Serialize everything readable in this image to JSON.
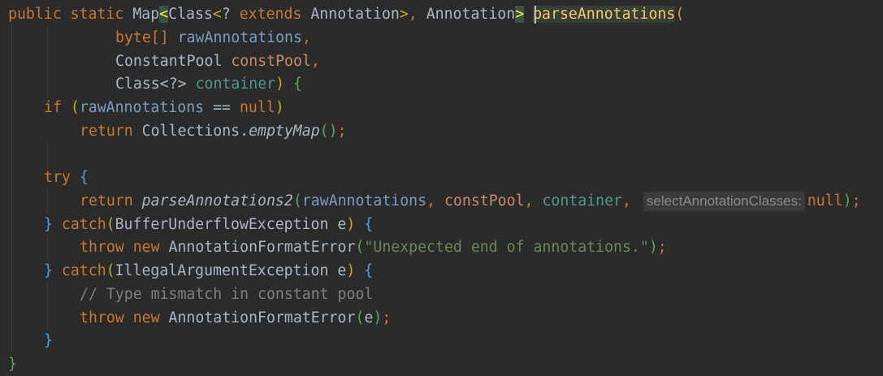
{
  "code": {
    "l1": {
      "public": "public",
      "static": "static",
      "map": "Map",
      "lt": "<",
      "class": "Class",
      "lt2": "<",
      "q": "?",
      "extends": "extends",
      "annotation": "Annotation",
      "gt2": ">",
      "comma": ",",
      "annotation2": "Annotation",
      "gt": ">",
      "method": "parseAnnotations",
      "open": "("
    },
    "l2": {
      "type": "byte[]",
      "name": "rawAnnotations",
      "comma": ","
    },
    "l3": {
      "type": "ConstantPool",
      "name": "constPool",
      "comma": ","
    },
    "l4": {
      "type": "Class",
      "gen": "<?>",
      "name": "container",
      "close": ")",
      "brace": "{"
    },
    "l5": {
      "if": "if",
      "open": "(",
      "name": "rawAnnotations",
      "op": " == ",
      "null": "null",
      "close": ")"
    },
    "l6": {
      "return": "return",
      "cls": "Collections.",
      "call": "emptyMap",
      "parens": "()",
      "semi": ";"
    },
    "l8": {
      "try": "try",
      "brace": "{"
    },
    "l9": {
      "return": "return",
      "call": "parseAnnotations2",
      "open": "(",
      "a1": "rawAnnotations",
      "sep1": ", ",
      "a2": "constPool",
      "sep2": ", ",
      "a3": "container",
      "sep3": ",",
      "hint": "selectAnnotationClasses:",
      "null": "null",
      "close": ")",
      "semi": ";"
    },
    "l10": {
      "close": "}",
      "catch": "catch",
      "open": "(",
      "exc": "BufferUnderflowException",
      "var": "e",
      "cparen": ")",
      "brace": "{"
    },
    "l11": {
      "throw": "throw",
      "new": "new",
      "cls": "AnnotationFormatError",
      "open": "(",
      "str": "\"Unexpected end of annotations.\"",
      "close": ")",
      "semi": ";"
    },
    "l12": {
      "close": "}",
      "catch": "catch",
      "open": "(",
      "exc": "IllegalArgumentException",
      "var": "e",
      "cparen": ")",
      "brace": "{"
    },
    "l13": {
      "comment": "// Type mismatch in constant pool"
    },
    "l14": {
      "throw": "throw",
      "new": "new",
      "cls": "AnnotationFormatError",
      "open": "(",
      "arg": "e",
      "close": ")",
      "semi": ";"
    },
    "l15": {
      "close": "}"
    },
    "l16": {
      "close": "}"
    }
  },
  "colors": {
    "background": "#2b2b2b",
    "keyword": "#cc7832",
    "default": "#a9b7c6",
    "parameter": "#7a9ec2",
    "method_decl": "#ffc66d",
    "string": "#6a8759",
    "comment": "#808080",
    "brace_blue": "#4ea0dc",
    "paren_yellow": "#c9a62a",
    "paren_green": "#5da75d"
  }
}
